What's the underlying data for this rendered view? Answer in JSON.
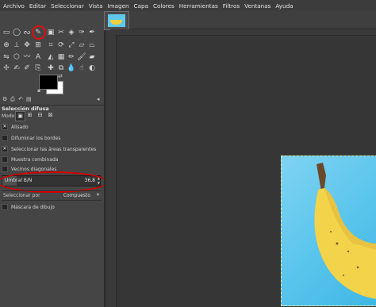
{
  "menubar": {
    "items": [
      "Archivo",
      "Editar",
      "Seleccionar",
      "Vista",
      "Imagen",
      "Capa",
      "Colores",
      "Herramientas",
      "Filtros",
      "Ventanas",
      "Ayuda"
    ]
  },
  "toolbox": {
    "active_tool": "fuzzy-select-tool",
    "tabs": [
      "tool-options-tab",
      "device-status-tab",
      "undo-history-tab",
      "images-tab"
    ]
  },
  "tool_options": {
    "title": "Selección difusa",
    "mode_label": "Modo:",
    "options": [
      {
        "label": "Alisado",
        "checked": true
      },
      {
        "label": "Difuminar los bordes",
        "checked": false
      },
      {
        "label": "Seleccionar las áreas transparentes",
        "checked": true
      },
      {
        "label": "Muestra combinada",
        "checked": false
      },
      {
        "label": "Vecinos diagonales",
        "checked": false
      }
    ],
    "threshold": {
      "label": "Umbral B/N",
      "value": "36,8",
      "fraction": 0.144
    },
    "select_by": {
      "label": "Seleccionar por",
      "value": "Compuesto"
    },
    "draw_mask": {
      "label": "Máscara de dibujo",
      "checked": false
    }
  },
  "colors": {
    "foreground": "#000000",
    "background": "#ffffff",
    "highlight": "#d30000"
  }
}
